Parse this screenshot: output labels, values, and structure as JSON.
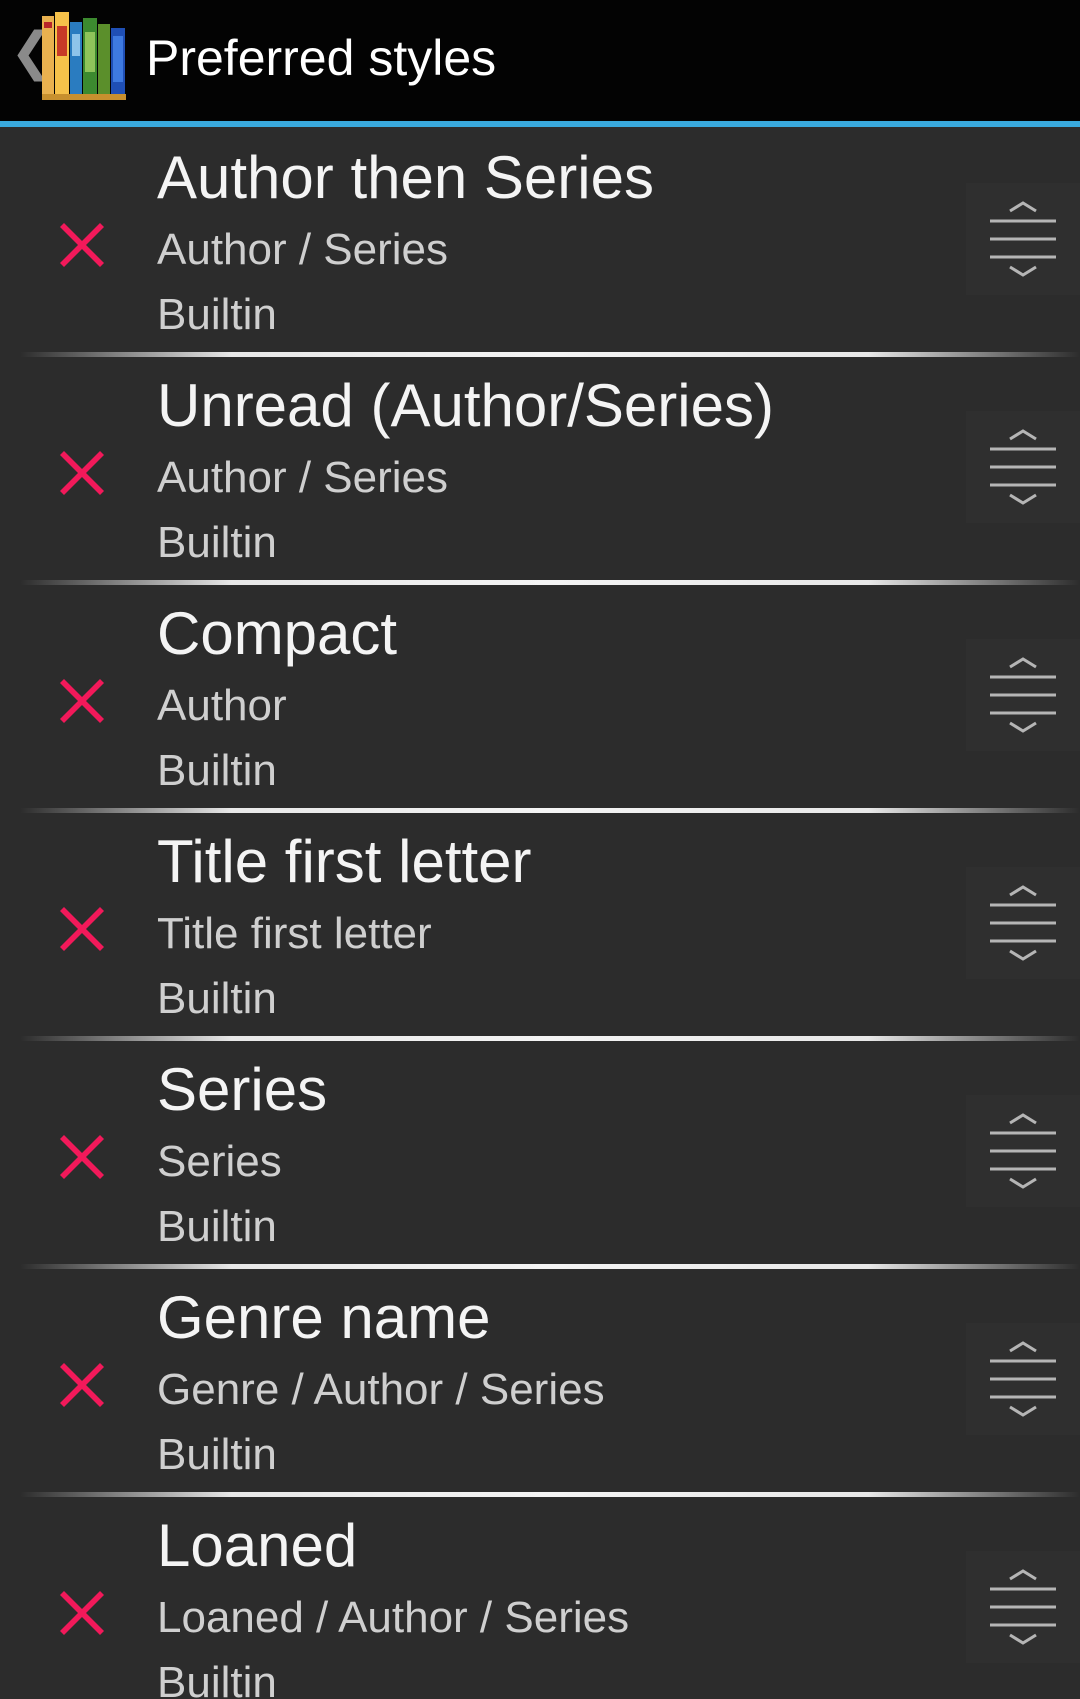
{
  "action_bar": {
    "title": "Preferred styles",
    "up_icon": "chevron-left-icon",
    "app_icon": "bookshelf-icon",
    "underline_color": "#39a9dd"
  },
  "colors": {
    "delete_icon": "#f2195a"
  },
  "styles": [
    {
      "name": "Author then Series",
      "groups": "Author / Series",
      "kind": "Builtin"
    },
    {
      "name": "Unread (Author/Series)",
      "groups": "Author / Series",
      "kind": "Builtin"
    },
    {
      "name": "Compact",
      "groups": "Author",
      "kind": "Builtin"
    },
    {
      "name": "Title first letter",
      "groups": "Title first letter",
      "kind": "Builtin"
    },
    {
      "name": "Series",
      "groups": "Series",
      "kind": "Builtin"
    },
    {
      "name": "Genre name",
      "groups": "Genre / Author / Series",
      "kind": "Builtin"
    },
    {
      "name": "Loaned",
      "groups": "Loaned / Author / Series",
      "kind": "Builtin"
    }
  ]
}
